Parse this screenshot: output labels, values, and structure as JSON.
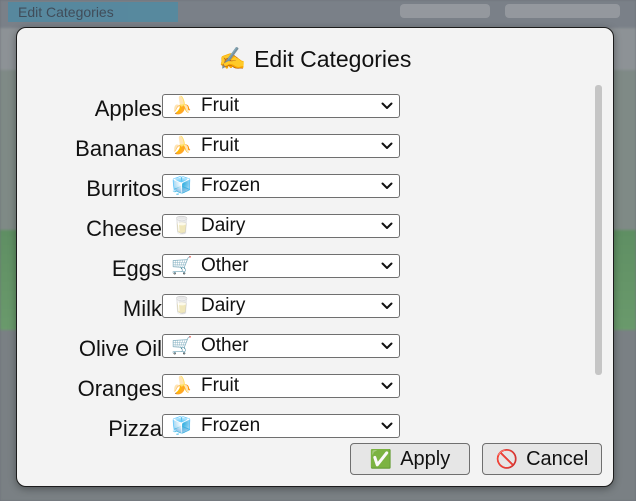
{
  "backdrop": {
    "title": "Edit Categories"
  },
  "dialog": {
    "title": "Edit Categories",
    "title_icon": "✍️",
    "rows": [
      {
        "label": "Apples",
        "category": "Fruit",
        "category_icon": "🍌"
      },
      {
        "label": "Bananas",
        "category": "Fruit",
        "category_icon": "🍌"
      },
      {
        "label": "Burritos",
        "category": "Frozen",
        "category_icon": "🧊"
      },
      {
        "label": "Cheese",
        "category": "Dairy",
        "category_icon": "🥛"
      },
      {
        "label": "Eggs",
        "category": "Other",
        "category_icon": "🛒"
      },
      {
        "label": "Milk",
        "category": "Dairy",
        "category_icon": "🥛"
      },
      {
        "label": "Olive Oil",
        "category": "Other",
        "category_icon": "🛒"
      },
      {
        "label": "Oranges",
        "category": "Fruit",
        "category_icon": "🍌"
      },
      {
        "label": "Pizza",
        "category": "Frozen",
        "category_icon": "🧊"
      }
    ],
    "buttons": {
      "apply": {
        "label": "Apply",
        "icon": "✅"
      },
      "cancel": {
        "label": "Cancel",
        "icon": "🚫"
      }
    }
  }
}
